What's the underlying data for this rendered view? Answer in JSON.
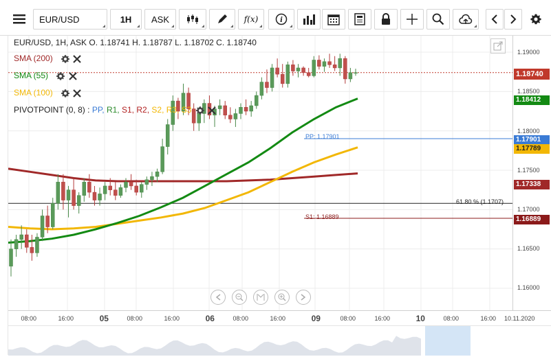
{
  "toolbar": {
    "symbol": "EUR/USD",
    "timeframe": "1H",
    "price_type": "ASK",
    "fx_label": "f(x)"
  },
  "legend": {
    "ohlc": "EUR/USD, 1H, ASK   O. 1.18741  H. 1.18787  L. 1.18702  C. 1.18740",
    "sma200": "SMA (200)",
    "sma55": "SMA (55)",
    "sma100": "SMA (100)",
    "pivot_prefix": "PIVOTPOINT (0, 8)",
    "pivot_items": [
      "PP,",
      "R1,",
      "S1,",
      "R2,",
      "S2,",
      "R3,",
      "S3"
    ]
  },
  "colors": {
    "sma200": "#a02828",
    "sma55": "#138a13",
    "sma100": "#f2b705",
    "pp": "#3a7bd5",
    "s1": "#8b1a1a",
    "up_candle": "#4a8a4a",
    "down_candle": "#b23a3a",
    "last_price": "#c0392b"
  },
  "price_axis": {
    "ticks": [
      "1.19000",
      "1.18500",
      "1.18000",
      "1.17500",
      "1.17000",
      "1.16500",
      "1.16000"
    ],
    "tags": {
      "last": "1.18740",
      "sma55": "1.18412",
      "pp": "1.17901",
      "sma100": "1.17789",
      "sma200": "1.17338",
      "s1": "1.16889"
    }
  },
  "chart_lines": {
    "pp_label": "PP: 1.17901",
    "fib_label": "61.80 % (1.1707)",
    "s1_label": "S1: 1.16889"
  },
  "time_axis": {
    "labels": [
      {
        "t": "08:00",
        "bold": false
      },
      {
        "t": "16:00",
        "bold": false
      },
      {
        "t": "05",
        "bold": true
      },
      {
        "t": "08:00",
        "bold": false
      },
      {
        "t": "16:00",
        "bold": false
      },
      {
        "t": "06",
        "bold": true
      },
      {
        "t": "08:00",
        "bold": false
      },
      {
        "t": "16:00",
        "bold": false
      },
      {
        "t": "09",
        "bold": true
      },
      {
        "t": "08:00",
        "bold": false
      },
      {
        "t": "16:00",
        "bold": false
      },
      {
        "t": "10",
        "bold": true
      },
      {
        "t": "08:00",
        "bold": false
      },
      {
        "t": "16:00",
        "bold": false
      },
      {
        "t": "10.11.2020",
        "bold": false
      }
    ]
  },
  "chart_data": {
    "type": "candlestick",
    "symbol": "EUR/USD",
    "interval": "1H",
    "ylim": [
      1.1575,
      1.1925
    ],
    "last": 1.1874,
    "candles": [
      [
        1.1628,
        1.1662,
        1.1615,
        1.165
      ],
      [
        1.165,
        1.1668,
        1.164,
        1.1662
      ],
      [
        1.1662,
        1.168,
        1.165,
        1.1668
      ],
      [
        1.1668,
        1.1675,
        1.1645,
        1.1652
      ],
      [
        1.1652,
        1.1668,
        1.1635,
        1.1645
      ],
      [
        1.1645,
        1.167,
        1.164,
        1.1665
      ],
      [
        1.1665,
        1.17,
        1.166,
        1.1692
      ],
      [
        1.1692,
        1.1705,
        1.167,
        1.1678
      ],
      [
        1.1678,
        1.1715,
        1.1675,
        1.1708
      ],
      [
        1.1708,
        1.1745,
        1.17,
        1.1735
      ],
      [
        1.1735,
        1.1745,
        1.17,
        1.1712
      ],
      [
        1.1712,
        1.173,
        1.169,
        1.1725
      ],
      [
        1.1725,
        1.174,
        1.17,
        1.1705
      ],
      [
        1.1705,
        1.1722,
        1.1695,
        1.1718
      ],
      [
        1.1718,
        1.174,
        1.171,
        1.1735
      ],
      [
        1.1735,
        1.1745,
        1.1715,
        1.1722
      ],
      [
        1.1722,
        1.173,
        1.1705,
        1.1712
      ],
      [
        1.1712,
        1.1728,
        1.1705,
        1.172
      ],
      [
        1.172,
        1.1735,
        1.1712,
        1.173
      ],
      [
        1.173,
        1.174,
        1.1718,
        1.1725
      ],
      [
        1.1725,
        1.1735,
        1.1712,
        1.1718
      ],
      [
        1.1718,
        1.1732,
        1.1715,
        1.1728
      ],
      [
        1.1728,
        1.174,
        1.1722,
        1.1735
      ],
      [
        1.1735,
        1.1745,
        1.1725,
        1.173
      ],
      [
        1.173,
        1.1738,
        1.1718,
        1.1722
      ],
      [
        1.1722,
        1.1735,
        1.1715,
        1.1732
      ],
      [
        1.1732,
        1.1742,
        1.1725,
        1.1738
      ],
      [
        1.1738,
        1.1748,
        1.173,
        1.1742
      ],
      [
        1.1742,
        1.1752,
        1.1735,
        1.1748
      ],
      [
        1.1748,
        1.179,
        1.1745,
        1.178
      ],
      [
        1.178,
        1.1815,
        1.177,
        1.1808
      ],
      [
        1.1808,
        1.1845,
        1.18,
        1.1838
      ],
      [
        1.1838,
        1.1842,
        1.1815,
        1.1825
      ],
      [
        1.1825,
        1.186,
        1.182,
        1.1848
      ],
      [
        1.1848,
        1.1855,
        1.182,
        1.1828
      ],
      [
        1.1828,
        1.1835,
        1.18,
        1.181
      ],
      [
        1.181,
        1.183,
        1.18,
        1.1822
      ],
      [
        1.1822,
        1.184,
        1.181,
        1.1835
      ],
      [
        1.1835,
        1.1845,
        1.1815,
        1.182
      ],
      [
        1.182,
        1.1832,
        1.1805,
        1.1828
      ],
      [
        1.1828,
        1.184,
        1.182,
        1.1832
      ],
      [
        1.1832,
        1.1838,
        1.1815,
        1.182
      ],
      [
        1.182,
        1.183,
        1.181,
        1.1815
      ],
      [
        1.1815,
        1.1828,
        1.1805,
        1.1822
      ],
      [
        1.1822,
        1.1835,
        1.1815,
        1.183
      ],
      [
        1.183,
        1.184,
        1.182,
        1.1825
      ],
      [
        1.1825,
        1.1838,
        1.1818,
        1.1832
      ],
      [
        1.1832,
        1.185,
        1.1828,
        1.1845
      ],
      [
        1.1845,
        1.1868,
        1.184,
        1.1862
      ],
      [
        1.1862,
        1.1878,
        1.1848,
        1.1855
      ],
      [
        1.1855,
        1.1885,
        1.185,
        1.188
      ],
      [
        1.188,
        1.1892,
        1.1868,
        1.1872
      ],
      [
        1.1872,
        1.1885,
        1.1855,
        1.186
      ],
      [
        1.186,
        1.1888,
        1.1855,
        1.1884
      ],
      [
        1.1884,
        1.189,
        1.187,
        1.1876
      ],
      [
        1.1876,
        1.1885,
        1.1868,
        1.188
      ],
      [
        1.188,
        1.1882,
        1.187,
        1.1874
      ],
      [
        1.1874,
        1.188,
        1.1868,
        1.187
      ],
      [
        1.187,
        1.1895,
        1.1868,
        1.189
      ],
      [
        1.189,
        1.1896,
        1.1878,
        1.1882
      ],
      [
        1.1882,
        1.1892,
        1.1875,
        1.1888
      ],
      [
        1.1888,
        1.1898,
        1.188,
        1.1884
      ],
      [
        1.1884,
        1.1895,
        1.1876,
        1.188
      ],
      [
        1.188,
        1.1898,
        1.187,
        1.1892
      ],
      [
        1.1892,
        1.1895,
        1.186,
        1.1866
      ],
      [
        1.1866,
        1.188,
        1.1862,
        1.1874
      ],
      [
        1.1874,
        1.1879,
        1.187,
        1.1874
      ]
    ],
    "sma55": [
      1.1658,
      1.166,
      1.1663,
      1.1668,
      1.1675,
      1.1683,
      1.1692,
      1.1703,
      1.1715,
      1.173,
      1.1745,
      1.176,
      1.1778,
      1.1798,
      1.1815,
      1.183,
      1.1841
    ],
    "sma100": [
      1.1678,
      1.1676,
      1.1675,
      1.1676,
      1.1678,
      1.1682,
      1.1686,
      1.169,
      1.1695,
      1.1702,
      1.1712,
      1.1722,
      1.1735,
      1.1748,
      1.176,
      1.177,
      1.1779
    ],
    "sma200": [
      1.1752,
      1.1748,
      1.1744,
      1.174,
      1.1737,
      1.1736,
      1.1736,
      1.1736,
      1.1736,
      1.1736,
      1.1736,
      1.1737,
      1.1738,
      1.174,
      1.1742,
      1.1744,
      1.1746
    ],
    "pp": 1.17901,
    "s1": 1.16889,
    "fib_61_8": 1.1707
  }
}
